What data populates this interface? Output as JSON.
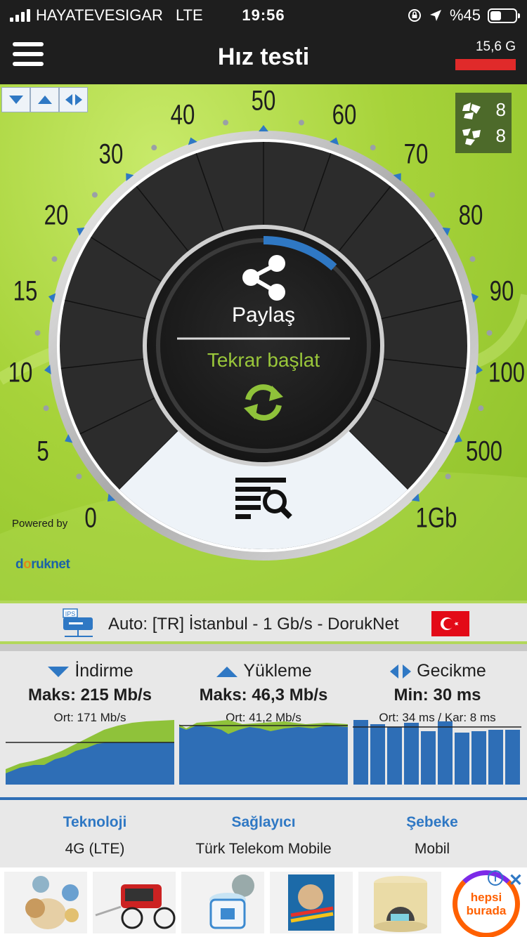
{
  "status_bar": {
    "carrier": "HAYATEVESIGAR",
    "network": "LTE",
    "time": "19:56",
    "battery": "%45",
    "battery_level": 0.45
  },
  "header": {
    "title": "Hız testi",
    "data_usage": "15,6 G",
    "usage_color": "#e02a2a"
  },
  "gauge": {
    "scale_labels": [
      "0",
      "5",
      "10",
      "15",
      "20",
      "30",
      "40",
      "50",
      "60",
      "70",
      "80",
      "90",
      "100",
      "500",
      "1Gb"
    ],
    "share_label": "Paylaş",
    "restart_label": "Tekrar başlat",
    "counter_servers": "8",
    "counter_peers": "8",
    "powered_by": "Powered by",
    "logo_part1": "d",
    "logo_part2": "o",
    "logo_part3": "ruknet",
    "accent": "#9ac73a"
  },
  "server": {
    "icon_label": "IPS",
    "label": "Auto: [TR] İstanbul - 1 Gb/s - DorukNet"
  },
  "stats": {
    "download": {
      "title": "İndirme",
      "max": "Maks: 215 Mb/s",
      "avg": "Ort: 171 Mb/s"
    },
    "upload": {
      "title": "Yükleme",
      "max": "Maks: 46,3 Mb/s",
      "avg": "Ort: 41,2 Mb/s"
    },
    "latency": {
      "title": "Gecikme",
      "min": "Min: 30 ms",
      "avg": "Ort: 34 ms / Kar: 8 ms"
    }
  },
  "info": {
    "technology_label": "Teknoloji",
    "technology_value": "4G (LTE)",
    "provider_label": "Sağlayıcı",
    "provider_value": "Türk Telekom Mobile",
    "network_label": "Şebeke",
    "network_value": "Mobil"
  },
  "ad": {
    "brand_line1": "hepsi",
    "brand_line2": "burada"
  }
}
